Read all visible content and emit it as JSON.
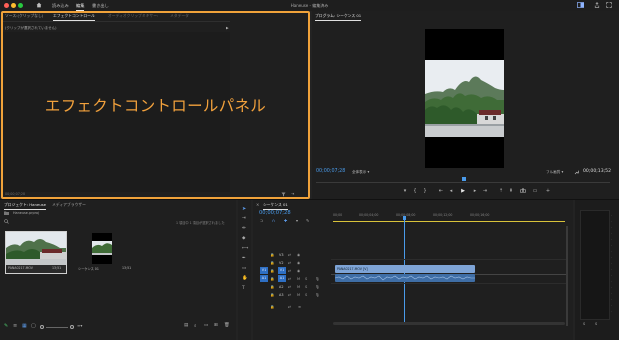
{
  "titlebar": {
    "tabs": [
      "読み込み",
      "編集",
      "書き出し"
    ],
    "active_tab": "編集",
    "window_title": "Haneuse - 編集済み"
  },
  "effect_controls": {
    "tabs": [
      "ソース:(クリップなし)",
      "エフェクトコントロール",
      "オーディオクリップミキサー:",
      "メタデータ"
    ],
    "active_tab": "エフェクトコントロール",
    "placeholder": "(クリップが選択されていません)",
    "overlay_label": "エフェクトコントロールパネル",
    "timecode": "00;00;07;28"
  },
  "program_monitor": {
    "tab": "プログラム: シーケンス 01",
    "timecode_left": "00;00;07;28",
    "fit_label": "全体表示",
    "quality_label": "フル画質",
    "timecode_right": "00;00;13;52"
  },
  "project": {
    "tabs": [
      "プロジェクト: Haneuse",
      "メディアブラウザー"
    ],
    "active_tab": "プロジェクト: Haneuse",
    "file": "Haneuse.prproj",
    "selection_status": "1 項目中 1 項目が選択されました",
    "items": [
      {
        "name": "PANA0217.MOV",
        "duration": "13;51"
      },
      {
        "name": "シーケンス 01",
        "duration": "13;51"
      }
    ]
  },
  "timeline": {
    "tab": "シーケンス 01",
    "timecode": "00;00;07;28",
    "ruler": [
      "00;00",
      "00;00;04;00",
      "00;00;08;00",
      "00;00;12;00",
      "00;00;16;00"
    ],
    "video_tracks": [
      "V3",
      "V2",
      "V1"
    ],
    "audio_tracks": [
      "A1",
      "A2",
      "A3"
    ],
    "clip_name": "PANA0217.MOV [V]"
  },
  "colors": {
    "accent": "#f0a23a",
    "timecode": "#4a9bea",
    "clip_video": "#7ea4d6",
    "clip_audio": "#3f6ea6"
  }
}
